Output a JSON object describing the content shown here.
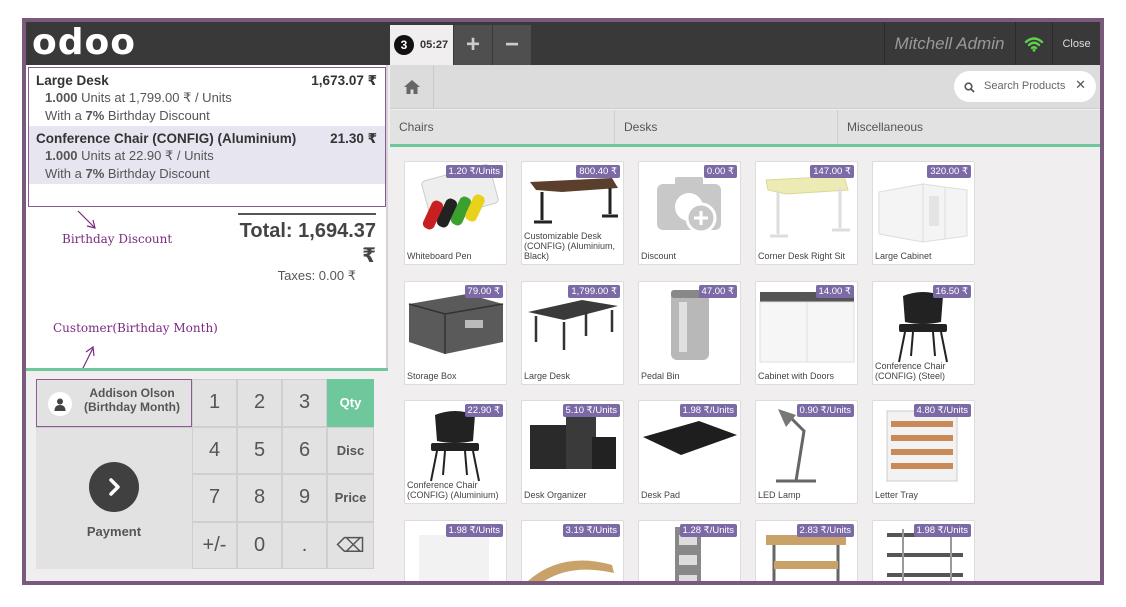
{
  "header": {
    "logo": "odoo",
    "order_number": "3",
    "order_time": "05:27",
    "add_order": "+",
    "remove_order": "−",
    "user": "Mitchell Admin",
    "close": "Close"
  },
  "orderlines": [
    {
      "name": "Large Desk",
      "price": "1,673.07 ₹",
      "qty": "1.000",
      "unit_text": "Units at 1,799.00 ₹ / Units",
      "discount_pre": "With a",
      "discount_val": "7%",
      "discount_post": "Birthday Discount"
    },
    {
      "name": "Conference Chair (CONFIG) (Aluminium)",
      "price": "21.30 ₹",
      "qty": "1.000",
      "unit_text": "Units at 22.90 ₹ / Units",
      "discount_pre": "With a",
      "discount_val": "7%",
      "discount_post": "Birthday Discount"
    }
  ],
  "summary": {
    "total": "Total: 1,694.37 ₹",
    "taxes": "Taxes: 0.00 ₹"
  },
  "annotations": {
    "birthday_discount": "Birthday  Discount",
    "customer": "Customer(Birthday  Month)"
  },
  "customer": {
    "name": "Addison Olson (Birthday Month)"
  },
  "payment": {
    "label": "Payment"
  },
  "numpad": {
    "keys": [
      "1",
      "2",
      "3",
      "Qty",
      "4",
      "5",
      "6",
      "Disc",
      "7",
      "8",
      "9",
      "Price",
      "+/-",
      "0",
      ".",
      "⌫"
    ],
    "active": "Qty"
  },
  "search": {
    "placeholder": "Search Products",
    "clear": "✕"
  },
  "categories": [
    "Chairs",
    "Desks",
    "Miscellaneous"
  ],
  "products": [
    {
      "name": "Whiteboard Pen",
      "price": "1.20 ₹/Units",
      "img": "pens"
    },
    {
      "name": "Customizable Desk (CONFIG) (Aluminium, Black)",
      "price": "800.40 ₹",
      "img": "desk-l"
    },
    {
      "name": "Discount",
      "price": "0.00 ₹",
      "img": "camera"
    },
    {
      "name": "Corner Desk Right Sit",
      "price": "147.00 ₹",
      "img": "desk-corner"
    },
    {
      "name": "Large Cabinet",
      "price": "320.00 ₹",
      "img": "cabinet"
    },
    {
      "name": "Storage Box",
      "price": "79.00 ₹",
      "img": "box"
    },
    {
      "name": "Large Desk",
      "price": "1,799.00 ₹",
      "img": "desk-large"
    },
    {
      "name": "Pedal Bin",
      "price": "47.00 ₹",
      "img": "bin"
    },
    {
      "name": "Cabinet with Doors",
      "price": "14.00 ₹",
      "img": "cabinet-doors"
    },
    {
      "name": "Conference Chair (CONFIG) (Steel)",
      "price": "16.50 ₹",
      "img": "chair"
    },
    {
      "name": "Conference Chair (CONFIG) (Aluminium)",
      "price": "22.90 ₹",
      "img": "chair"
    },
    {
      "name": "Desk Organizer",
      "price": "5.10 ₹/Units",
      "img": "organizer"
    },
    {
      "name": "Desk Pad",
      "price": "1.98 ₹/Units",
      "img": "pad"
    },
    {
      "name": "LED Lamp",
      "price": "0.90 ₹/Units",
      "img": "lamp"
    },
    {
      "name": "Letter Tray",
      "price": "4.80 ₹/Units",
      "img": "tray"
    },
    {
      "name": "",
      "price": "1.98 ₹/Units",
      "img": "blank"
    },
    {
      "name": "",
      "price": "3.19 ₹/Units",
      "img": "stand"
    },
    {
      "name": "",
      "price": "1.28 ₹/Units",
      "img": "holder"
    },
    {
      "name": "",
      "price": "2.83 ₹/Units",
      "img": "desk-small"
    },
    {
      "name": "",
      "price": "1.98 ₹/Units",
      "img": "shelf"
    }
  ],
  "colors": {
    "accent": "#6ec89b",
    "brand": "#7a5a7c",
    "price_badge": "#7b6aa6",
    "header": "#393939"
  }
}
